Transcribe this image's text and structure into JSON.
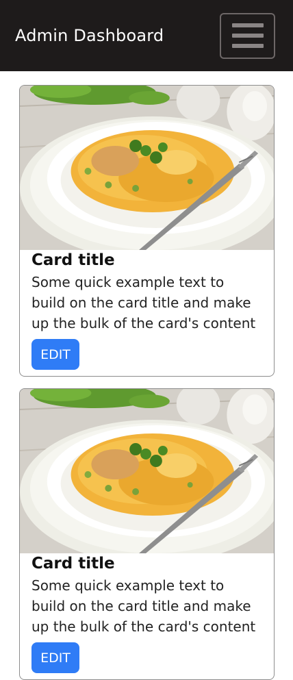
{
  "navbar": {
    "brand": "Admin Dashboard",
    "toggle_icon": "hamburger-menu-icon"
  },
  "cards": [
    {
      "image": "pasta-plate-photo",
      "title": "Card title",
      "text": "Some quick example text to build on the card title and make up the bulk of the card's content",
      "button_label": "EDIT"
    },
    {
      "image": "pasta-plate-photo",
      "title": "Card title",
      "text": "Some quick example text to build on the card title and make up the bulk of the card's content",
      "button_label": "EDIT"
    }
  ],
  "colors": {
    "navbar_bg": "#1e1b1b",
    "button_bg": "#2f7cf6"
  }
}
